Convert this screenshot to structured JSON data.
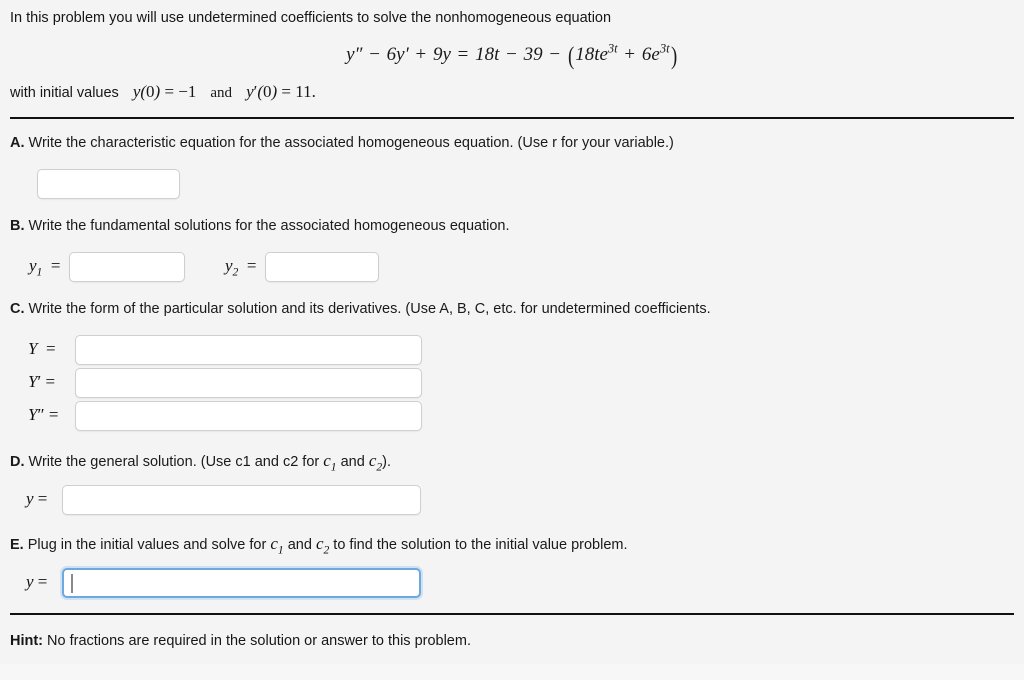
{
  "intro": {
    "text": "In this problem you will use undetermined coefficients to solve the nonhomogeneous equation",
    "equation": "y″ − 6y′ + 9y = 18t − 39 − (18te³ᵗ + 6e³ᵗ)",
    "initial_values_label": "with initial values",
    "initial_value_1": "y(0) = −1",
    "initial_values_conjunction": "and",
    "initial_value_2": "y′(0) = 11."
  },
  "sections": {
    "a": {
      "letter": "A.",
      "prompt": "Write the characteristic equation for the associated homogeneous equation. (Use r for your variable.)",
      "input_value": ""
    },
    "b": {
      "letter": "B.",
      "prompt": "Write the fundamental solutions for the associated homogeneous equation.",
      "label_y1": "y₁  =",
      "label_y2": "y₂  =",
      "input_y1_value": "",
      "input_y2_value": ""
    },
    "c": {
      "letter": "C.",
      "prompt": "Write the form of the particular solution and its derivatives. (Use A, B, C, etc. for undetermined coefficients.",
      "label_Y": "Y   =",
      "label_Yp": "Y′  =",
      "label_Ypp": "Y″ =",
      "input_Y_value": "",
      "input_Yp_value": "",
      "input_Ypp_value": ""
    },
    "d": {
      "letter": "D.",
      "prompt_part1": "Write the general solution. (Use c1 and c2 for ",
      "prompt_c1": "c₁",
      "prompt_mid": " and ",
      "prompt_c2": "c₂",
      "prompt_end": ").",
      "label_y": "y =",
      "input_value": ""
    },
    "e": {
      "letter": "E.",
      "prompt_part1": "Plug in the initial values and solve for ",
      "prompt_c1": "c₁",
      "prompt_mid": " and ",
      "prompt_c2": "c₂",
      "prompt_end": " to find the solution to the initial value problem.",
      "label_y": "y =",
      "input_value": "",
      "focused": true
    }
  },
  "hint": {
    "label": "Hint:",
    "text": "No fractions are required in the solution or answer to this problem."
  },
  "colors": {
    "background": "#f4f4f4",
    "text": "#161616",
    "rule": "#111111",
    "field_border": "#cfcfcf",
    "focus_border": "#6fa8dc",
    "focus_glow": "#cfe2f5"
  }
}
